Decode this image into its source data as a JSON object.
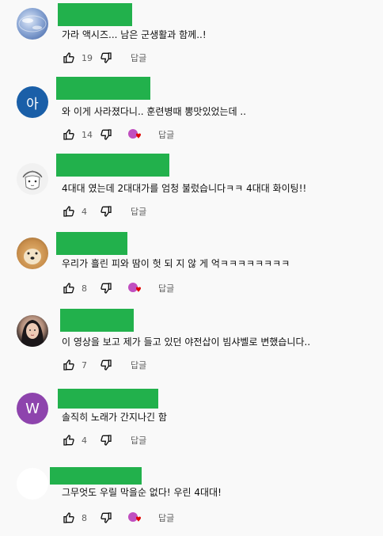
{
  "comments": [
    {
      "avatar_letter": "",
      "text": "가라 액시즈... 남은 군생활과 함께..!",
      "likes": "19",
      "hearted": false,
      "reply_label": "답글"
    },
    {
      "avatar_letter": "아",
      "text": "와 이게 사라졌다니.. 훈련병때 뽕맛있었는데 ..",
      "likes": "14",
      "hearted": true,
      "reply_label": "답글"
    },
    {
      "avatar_letter": "",
      "text": "4대대 였는데 2대대가를 엄청 불렀습니다ㅋㅋ 4대대 화이팅!!",
      "likes": "4",
      "hearted": false,
      "reply_label": "답글"
    },
    {
      "avatar_letter": "",
      "text": "우리가 흘린 피와 땀이 헛 되 지 않 게 억ㅋㅋㅋㅋㅋㅋㅋㅋ",
      "likes": "8",
      "hearted": true,
      "reply_label": "답글"
    },
    {
      "avatar_letter": "",
      "text": "이 영상을 보고 제가 들고 있던 야전삽이 빔샤벨로 변했습니다..",
      "likes": "7",
      "hearted": false,
      "reply_label": "답글"
    },
    {
      "avatar_letter": "W",
      "text": "솔직히 노래가 간지나긴 함",
      "likes": "4",
      "hearted": false,
      "reply_label": "답글"
    },
    {
      "avatar_letter": "",
      "text": "그무엇도 우릴 막을순 없다! 우린 4대대!",
      "likes": "8",
      "hearted": true,
      "reply_label": "답글"
    }
  ],
  "colors": {
    "redaction": "#22b14c",
    "heart": "#e00000",
    "creator_badge": "#c04fc0"
  }
}
